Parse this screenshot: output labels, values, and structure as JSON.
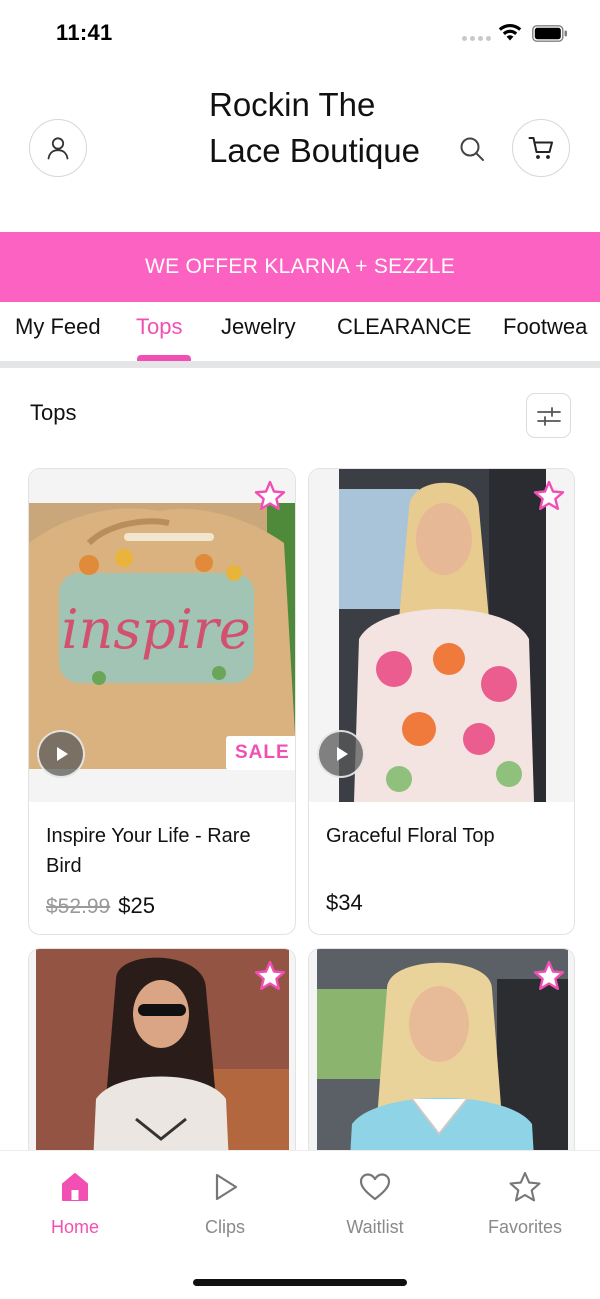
{
  "status_bar": {
    "time": "11:41"
  },
  "header": {
    "brand_title": "Rockin The Lace Boutique",
    "account_icon": "user-icon",
    "search_icon": "search-icon",
    "cart_icon": "cart-icon"
  },
  "promo_banner": {
    "text": "WE OFFER KLARNA + SEZZLE"
  },
  "tabs": [
    {
      "label": "My Feed",
      "active": false
    },
    {
      "label": "Tops",
      "active": true
    },
    {
      "label": "Jewelry",
      "active": false
    },
    {
      "label": "CLEARANCE",
      "active": false
    },
    {
      "label": "Footwea",
      "active": false
    }
  ],
  "section": {
    "title": "Tops",
    "filter_icon": "sliders-icon"
  },
  "products": [
    {
      "name": "Inspire Your Life - Rare Bird",
      "old_price": "$52.99",
      "price": "$25",
      "badge": "SALE",
      "has_video": true
    },
    {
      "name": "Graceful Floral Top",
      "price": "$34",
      "has_video": true
    },
    {
      "name": "",
      "price": ""
    },
    {
      "name": "",
      "price": ""
    }
  ],
  "bottom_nav": [
    {
      "label": "Home",
      "icon": "home-icon",
      "active": true
    },
    {
      "label": "Clips",
      "icon": "play-icon",
      "active": false
    },
    {
      "label": "Waitlist",
      "icon": "heart-icon",
      "active": false
    },
    {
      "label": "Favorites",
      "icon": "star-icon",
      "active": false
    }
  ],
  "colors": {
    "accent": "#f24fb5",
    "banner": "#fb62c1",
    "divider": "#e3e5e7"
  }
}
